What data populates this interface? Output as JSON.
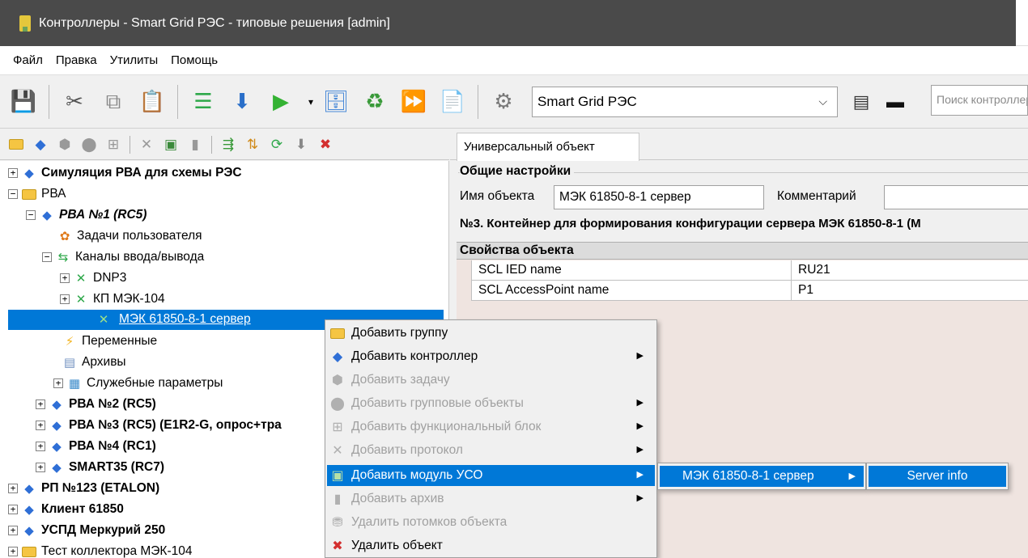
{
  "window": {
    "title": "Контроллеры - Smart Grid РЭС - типовые решения [admin]"
  },
  "menu": [
    "Файл",
    "Правка",
    "Утилиты",
    "Помощь"
  ],
  "toolbar": {
    "project_select": "Smart Grid РЭС",
    "search_placeholder": "Поиск контроллер"
  },
  "tab": {
    "label": "Универсальный объект"
  },
  "general": {
    "title": "Общие настройки",
    "name_label": "Имя объекта",
    "name_value": "МЭК 61850-8-1 сервер",
    "comment_label": "Комментарий",
    "comment_value": "",
    "note": "№3. Контейнер для формирования конфигурации сервера МЭК 61850-8-1 (М"
  },
  "props": {
    "title": "Свойства объекта",
    "rows": [
      {
        "name": "SCL IED name",
        "value": "RU21"
      },
      {
        "name": "SCL AccessPoint name",
        "value": "P1"
      }
    ]
  },
  "tree": {
    "items": [
      "Симуляция РВА для схемы РЭС",
      "РВА",
      "РВА №1 (RC5)",
      "Задачи пользователя",
      "Каналы ввода/вывода",
      "DNP3",
      "КП МЭК-104",
      "МЭК 61850-8-1 сервер",
      "Переменные",
      "Архивы",
      "Служебные параметры",
      "РВА №2 (RC5)",
      "РВА №3 (RC5) (E1R2-G, опрос+тра",
      "РВА №4 (RC1)",
      "SMART35 (RC7)",
      "РП №123 (ETALON)",
      "Клиент 61850",
      "УСПД Меркурий 250",
      "Тест коллектора МЭК-104"
    ]
  },
  "context_menu": {
    "items": [
      "Добавить группу",
      "Добавить контроллер",
      "Добавить задачу",
      "Добавить групповые объекты",
      "Добавить функциональный блок",
      "Добавить протокол",
      "Добавить модуль УСО",
      "Добавить архив",
      "Удалить потомков объекта",
      "Удалить объект"
    ],
    "submenu1": "МЭК 61850-8-1 сервер",
    "submenu2": "Server info"
  },
  "colors": {
    "selection": "#0078d7",
    "titlebar": "#4a4a4a"
  }
}
